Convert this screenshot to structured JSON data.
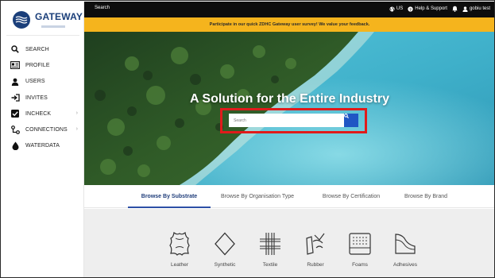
{
  "brand": {
    "name": "GATEWAY"
  },
  "sidebar": {
    "items": [
      {
        "label": "SEARCH",
        "icon": "search-icon",
        "has_chevron": false
      },
      {
        "label": "PROFILE",
        "icon": "id-card-icon",
        "has_chevron": false
      },
      {
        "label": "USERS",
        "icon": "user-icon",
        "has_chevron": false
      },
      {
        "label": "INVITES",
        "icon": "sign-in-icon",
        "has_chevron": false
      },
      {
        "label": "INCHECK",
        "icon": "checkbox-icon",
        "has_chevron": true
      },
      {
        "label": "CONNECTIONS",
        "icon": "connections-icon",
        "has_chevron": true
      },
      {
        "label": "WATERDATA",
        "icon": "water-drop-icon",
        "has_chevron": false
      }
    ],
    "chevron": "›"
  },
  "topbar": {
    "title": "Search",
    "region": "US",
    "help": "Help & Support",
    "user": "gobiu test"
  },
  "banner": {
    "text": "Participate in our quick ZDHC Gateway user survey! We value your feedback."
  },
  "hero": {
    "title": "A Solution for the Entire Industry",
    "search_placeholder": "Search"
  },
  "tabs": [
    {
      "label": "Browse By Substrate",
      "active": true
    },
    {
      "label": "Browse By Organisation Type",
      "active": false
    },
    {
      "label": "Browse By Certification",
      "active": false
    },
    {
      "label": "Browse By Brand",
      "active": false
    }
  ],
  "substrates": [
    {
      "label": "Leather",
      "icon": "leather-hide-icon"
    },
    {
      "label": "Synthetic",
      "icon": "diamond-icon"
    },
    {
      "label": "Textile",
      "icon": "textile-weave-icon"
    },
    {
      "label": "Rubber",
      "icon": "rubber-icon"
    },
    {
      "label": "Foams",
      "icon": "foam-icon"
    },
    {
      "label": "Adhesives",
      "icon": "adhesive-icon"
    }
  ],
  "colors": {
    "topbar": "#0d0d0d",
    "banner": "#f5b41d",
    "brand_blue": "#1b3f7a",
    "search_button": "#2056c4",
    "highlight_box": "#e01b1b"
  }
}
